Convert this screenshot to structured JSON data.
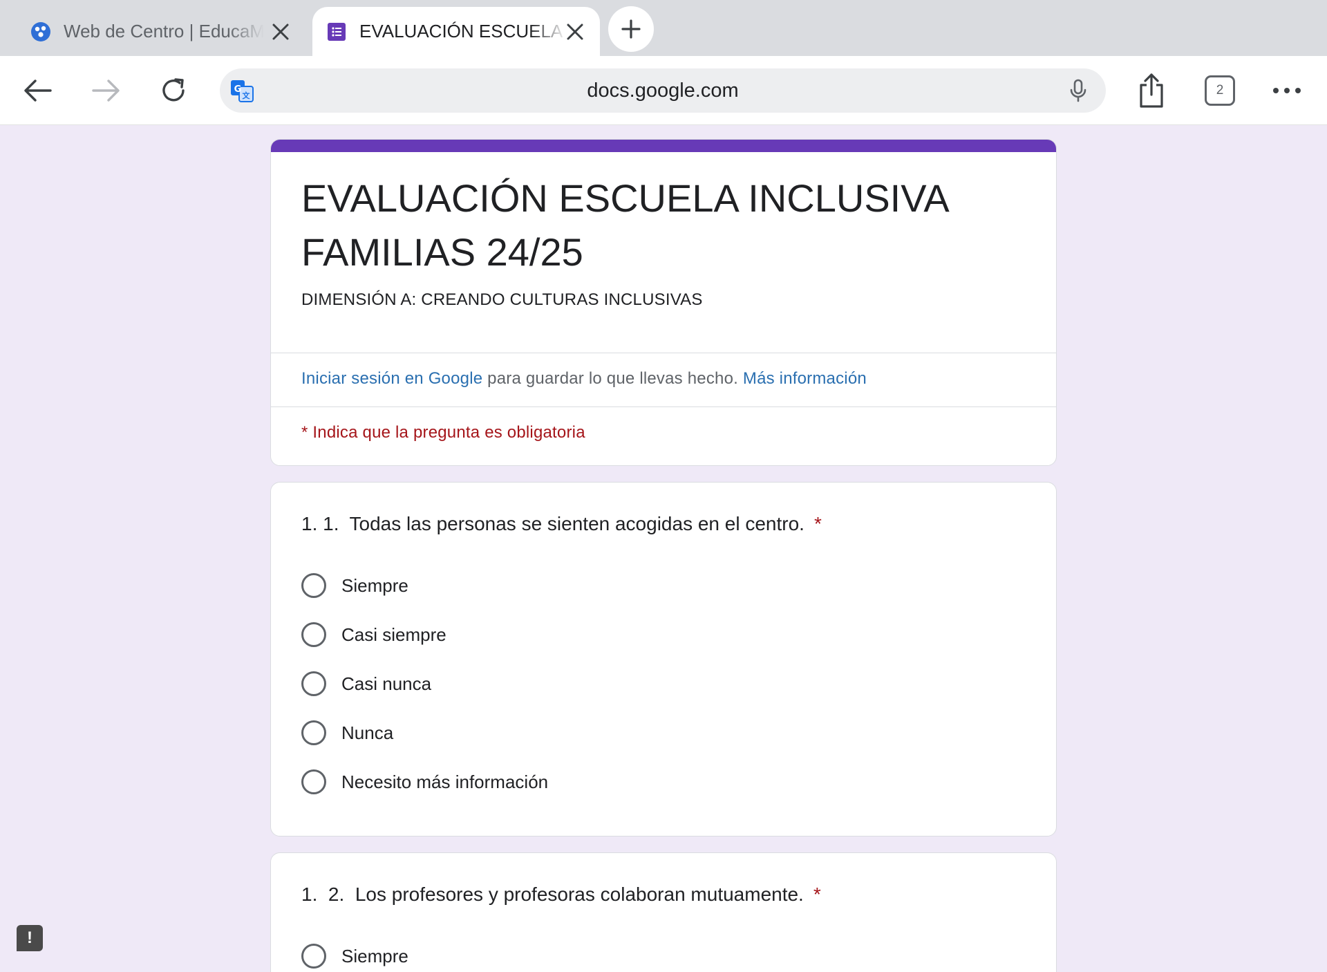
{
  "browser": {
    "tabs": [
      {
        "title": "Web de Centro | EducaMadrid",
        "active": false,
        "favicon": "educamadrid-icon"
      },
      {
        "title": "EVALUACIÓN ESCUELA INCLUSIVA FAMILIAS 24/25",
        "active": true,
        "favicon": "google-forms-icon"
      }
    ],
    "address": "docs.google.com",
    "tab_count": "2",
    "colors": {
      "tabstrip": "#dadce0",
      "forms_purple": "#673ab7"
    }
  },
  "form": {
    "title": "EVALUACIÓN ESCUELA INCLUSIVA FAMILIAS 24/25",
    "description": "DIMENSIÓN A: CREANDO CULTURAS INCLUSIVAS",
    "signin_link": "Iniciar sesión en Google",
    "signin_text": " para guardar lo que llevas hecho. ",
    "more_info_link": "Más información",
    "required_note": "* Indica que la pregunta es obligatoria",
    "questions": [
      {
        "title": "1. 1.  Todas las personas se sienten acogidas en el centro.",
        "required_mark": "*",
        "options": [
          "Siempre",
          "Casi siempre",
          "Casi nunca",
          "Nunca",
          "Necesito más información"
        ]
      },
      {
        "title": "1.  2.  Los profesores y profesoras colaboran mutuamente.",
        "required_mark": "*",
        "options": [
          "Siempre"
        ]
      }
    ],
    "feedback_glyph": "!"
  }
}
